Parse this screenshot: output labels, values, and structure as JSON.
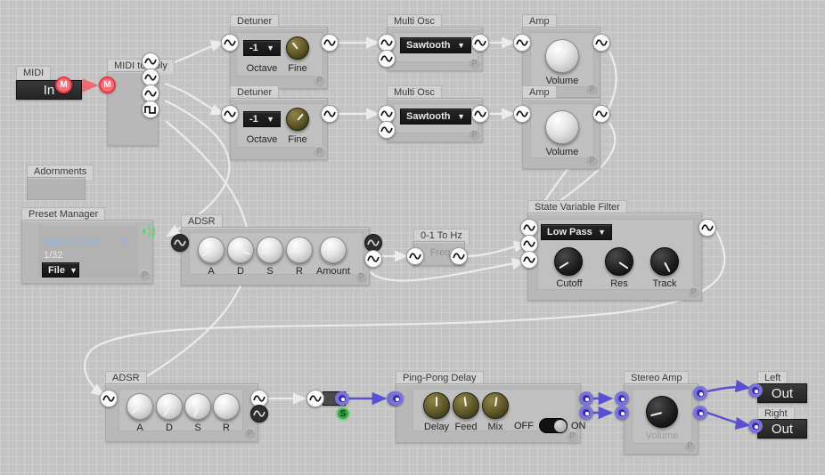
{
  "app": {
    "canvas_label": "patch-editor-canvas"
  },
  "modules": {
    "midi_in": {
      "title": "MIDI",
      "value": "In",
      "port_label": "M"
    },
    "midi_to_poly": {
      "title": "MIDI to Poly"
    },
    "detuner_1": {
      "title": "Detuner",
      "octave_value": "-1",
      "octave_label": "Octave",
      "fine_label": "Fine",
      "pbadge": "P"
    },
    "detuner_2": {
      "title": "Detuner",
      "octave_value": "-1",
      "octave_label": "Octave",
      "fine_label": "Fine",
      "pbadge": "P"
    },
    "multi_osc_1": {
      "title": "Multi Osc",
      "waveform": "Sawtooth",
      "pbadge": "P"
    },
    "multi_osc_2": {
      "title": "Multi Osc",
      "waveform": "Sawtooth",
      "pbadge": "P"
    },
    "amp_1": {
      "title": "Amp",
      "volume_label": "Volume",
      "pbadge": "P"
    },
    "amp_2": {
      "title": "Amp",
      "volume_label": "Volume",
      "pbadge": "P"
    },
    "adornments": {
      "title": "Adornments"
    },
    "preset_manager": {
      "title": "Preset Manager",
      "preset_name": "Tekno Honk",
      "preset_count": "1/32",
      "file_label": "File",
      "pbadge": "P",
      "signal_icon": "signal-icon"
    },
    "adsr_top": {
      "title": "ADSR",
      "k1": "A",
      "k2": "D",
      "k3": "S",
      "k4": "R",
      "k5": "Amount",
      "pbadge": "P"
    },
    "zero_one_to_hz": {
      "title": "0-1 To Hz",
      "param": "Freq"
    },
    "svf": {
      "title": "State Variable Filter",
      "mode": "Low Pass",
      "k1": "Cutoff",
      "k2": "Res",
      "k3": "Track",
      "pbadge": "P"
    },
    "adsr_bottom": {
      "title": "ADSR",
      "k1": "A",
      "k2": "D",
      "k3": "S",
      "k4": "R",
      "pbadge": "P"
    },
    "signal_node": {
      "badge": "S"
    },
    "ping_pong": {
      "title": "Ping-Pong Delay",
      "k1": "Delay",
      "k2": "Feed",
      "k3": "Mix",
      "off_label": "OFF",
      "on_label": "ON",
      "state": "ON",
      "pbadge": "P"
    },
    "stereo_amp": {
      "title": "Stereo Amp",
      "volume_label": "Volume",
      "pbadge": "P"
    },
    "out_left": {
      "title": "Left",
      "value": "Out"
    },
    "out_right": {
      "title": "Right",
      "value": "Out"
    }
  },
  "colors": {
    "canvas_bg": "#c3c3c3",
    "grid_line": "#cfcfcf",
    "module_body": "#b8b8b8",
    "module_title": "#d2d2d2",
    "midi_port": "#f4727a",
    "signal_blue": "#3b2fa8",
    "signal_green": "#3aa34a",
    "preset_text": "#8fb5e8",
    "wire_audio": "#f2f2f2"
  }
}
